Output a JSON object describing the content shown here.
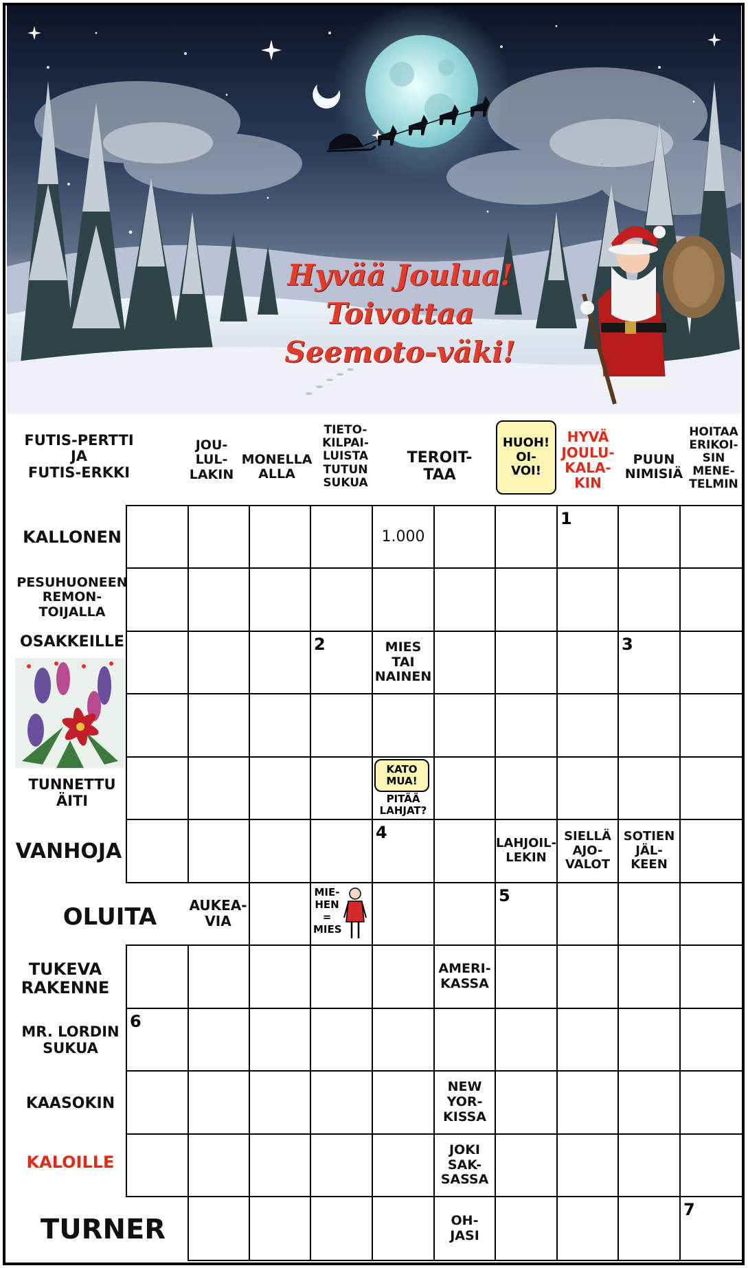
{
  "image": {
    "greeting": [
      "Hyvää Joulua!",
      "Toivottaa",
      "Seemoto-väki!"
    ]
  },
  "top_headers": [
    {
      "text": "FUTIS-PERTTI\nJA\nFUTIS-ERKKI",
      "color": "#111111"
    },
    {
      "text": "JOU-\nLUL-\nLAKIN",
      "color": "#111111"
    },
    {
      "text": "MONELLA\nALLA",
      "color": "#111111"
    },
    {
      "text": "TIETO-\nKILPAI-\nLUISTA\nTUTUN\nSUKUA",
      "color": "#111111"
    },
    {
      "text": "TEROIT-\nTAA",
      "color": "#111111"
    },
    {
      "text": "HUOH!\nOI-\nVOI!",
      "color": "#111111"
    },
    {
      "text": "HYVÄ\nJOULU-\nKALA-\nKIN",
      "color": "#e02a1a"
    },
    {
      "text": "PUUN\nNIMISIÄ",
      "color": "#111111"
    },
    {
      "text": "HOITAA\nERIKOI-\nSIN\nMENE-\nTELMIN",
      "color": "#111111"
    }
  ],
  "row_headers": [
    {
      "text": "KALLONEN",
      "color": "#111111"
    },
    {
      "text": "PESUHUONEEN\nREMON-\nTOIJALLA",
      "color": "#111111"
    },
    {
      "text": "OSAKKEILLE",
      "color": "#111111"
    },
    {
      "text": "",
      "color": "#111111"
    },
    {
      "text": "TUNNETTU\nÄITI",
      "color": "#111111"
    },
    {
      "text": "VANHOJA",
      "color": "#111111"
    },
    {
      "text": "OLUITA",
      "color": "#111111"
    },
    {
      "text": "TUKEVA\nRAKENNE",
      "color": "#111111"
    },
    {
      "text": "MR. LORDIN\nSUKUA",
      "color": "#111111"
    },
    {
      "text": "KAASOKIN",
      "color": "#111111"
    },
    {
      "text": "KALOILLE",
      "color": "#e02a1a"
    },
    {
      "text": "TURNER",
      "color": "#111111"
    }
  ],
  "clue_cells": {
    "r0c4": "1.000",
    "r2c4": "MIES\nTAI\nNAINEN",
    "r4c4_bubble": "KATO\nMUA!",
    "r4c4_text": "PITÄÄ\nLAHJAT?",
    "r5c6": "LAHJOIL-\nLEKIN",
    "r5c7": "SIELLÄ\nAJO-\nVALOT",
    "r5c8": "SOTIEN\nJÄL-\nKEEN",
    "r6c1": "AUKEA-\nVIA",
    "r6c3": "MIE-\nHEN\n=\nMIES",
    "r7c5": "AMERI-\nKASSA",
    "r9c5": "NEW\nYOR-\nKISSA",
    "r10c5": "JOKI\nSAK-\nSASSA",
    "r11c5": "OH-\nJASI"
  },
  "numbers": {
    "r0c7": "1",
    "r2c3": "2",
    "r2c8": "3",
    "r5c4": "4",
    "r6c6": "5",
    "r8c0": "6",
    "r11c9": "7"
  }
}
